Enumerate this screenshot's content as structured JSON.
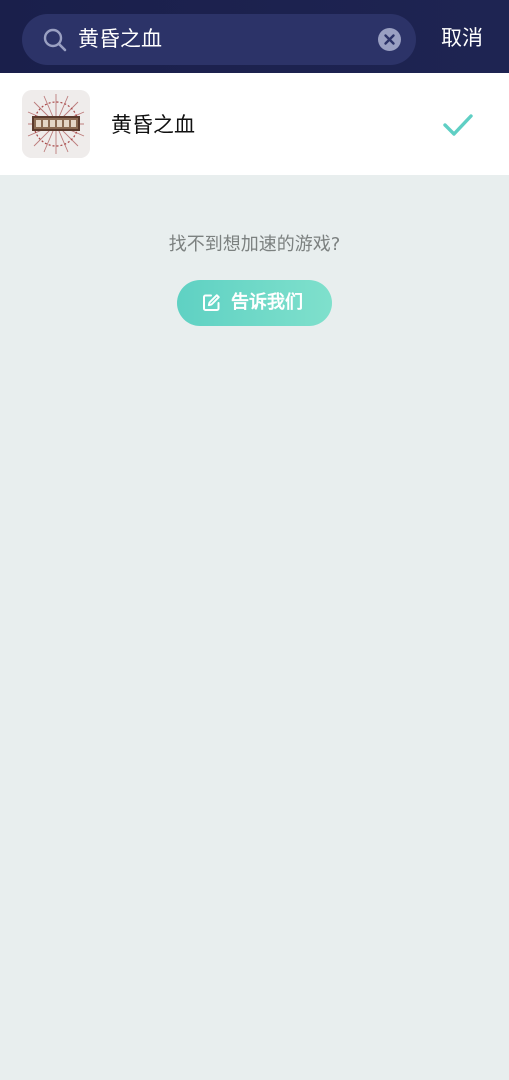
{
  "search": {
    "query": "黄昏之血",
    "cancel_label": "取消",
    "icon": "search-icon",
    "clear_icon": "clear-icon"
  },
  "results": [
    {
      "title": "黄昏之血",
      "selected": true,
      "icon": "game-thumbnail",
      "check_icon": "check-icon"
    }
  ],
  "empty_hint": {
    "text": "找不到想加速的游戏?",
    "button_label": "告诉我们",
    "button_icon": "edit-icon"
  },
  "colors": {
    "header_bg": "#1c224e",
    "search_bg": "#2c3368",
    "accent": "#5fcfc4",
    "page_bg": "#e8eeee"
  }
}
